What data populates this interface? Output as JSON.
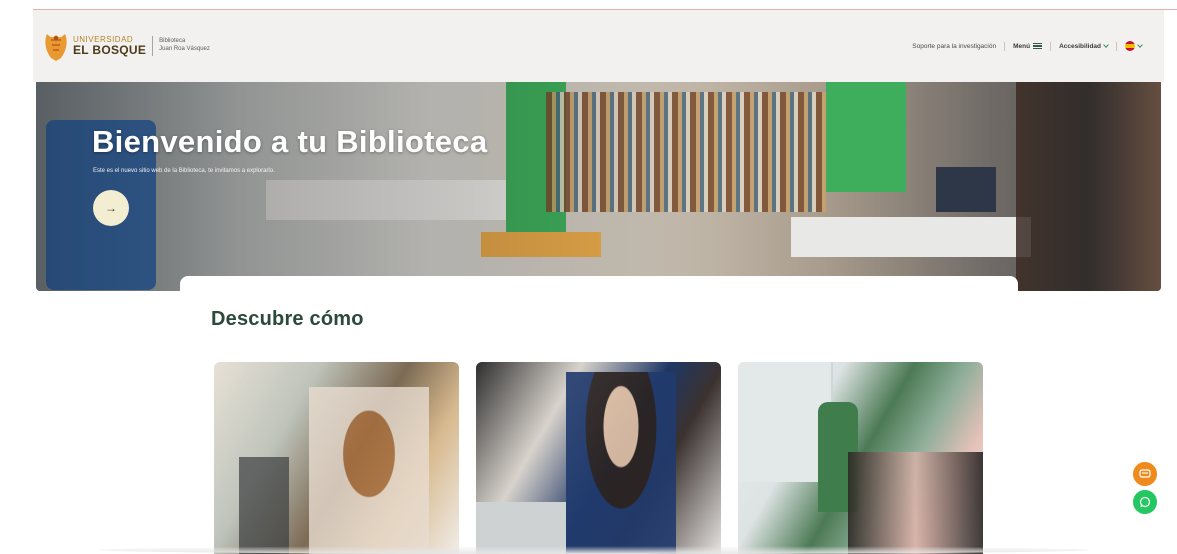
{
  "header": {
    "logo": {
      "uni_text": "UNIVERSIDAD",
      "name_text": "EL BOSQUE",
      "sub_line1": "Biblioteca",
      "sub_line2": "Juan Roa Vásquez"
    },
    "nav": {
      "research_support": "Soporte para la investigación",
      "menu_label": "Menú",
      "accessibility_label": "Accesibilidad",
      "language_icon": "spain-flag-icon"
    }
  },
  "hero": {
    "title": "Bienvenido a tu Biblioteca",
    "subtitle": "Este es el nuevo sitio web de la Biblioteca, te invitamos a explorarlo.",
    "button_icon": "→"
  },
  "section": {
    "title": "Descubre cómo"
  },
  "tiles": [
    {
      "icon": "photo-students-computers"
    },
    {
      "icon": "photo-student-smiling"
    },
    {
      "icon": "photo-classroom-presentation"
    }
  ],
  "colors": {
    "brand_green": "#2b4a3c",
    "chat_orange": "#f08a1c",
    "whatsapp_green": "#23c861",
    "header_bg": "#f3f1ef"
  }
}
